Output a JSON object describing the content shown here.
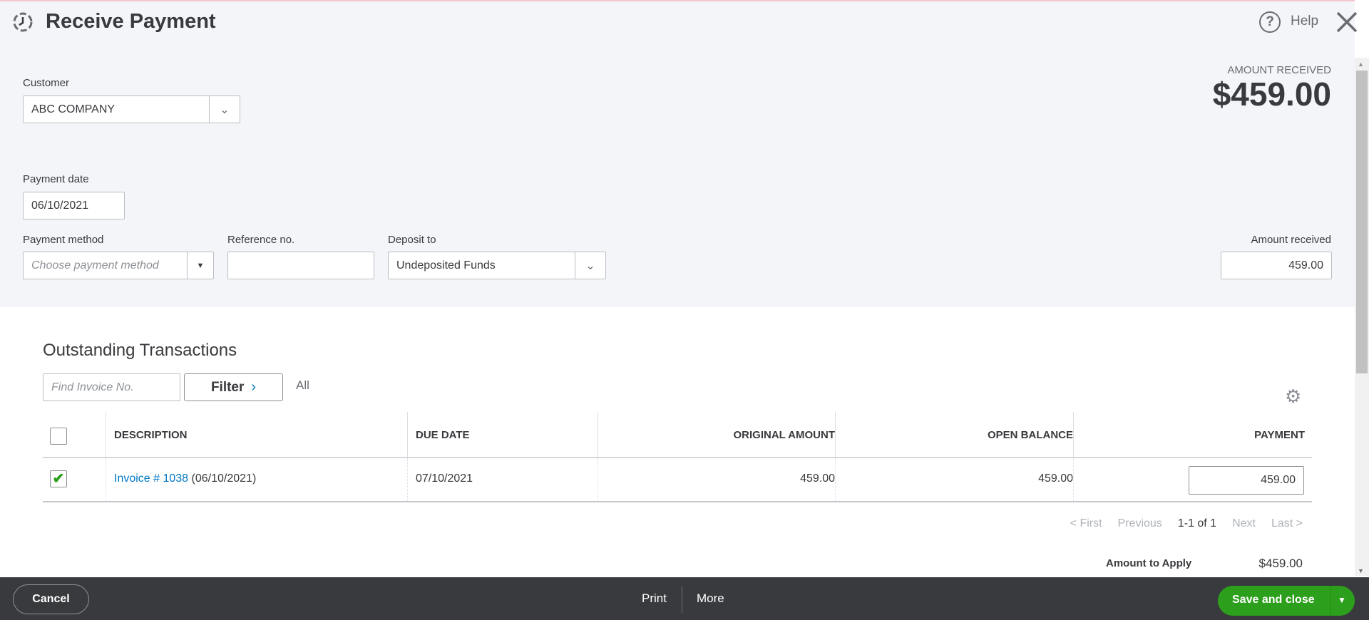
{
  "header": {
    "title": "Receive Payment",
    "help": "Help"
  },
  "amount_summary": {
    "label": "AMOUNT RECEIVED",
    "value": "$459.00"
  },
  "form": {
    "customer": {
      "label": "Customer",
      "value": "ABC COMPANY"
    },
    "payment_date": {
      "label": "Payment date",
      "value": "06/10/2021"
    },
    "payment_method": {
      "label": "Payment method",
      "placeholder": "Choose payment method"
    },
    "reference_no": {
      "label": "Reference no.",
      "value": ""
    },
    "deposit_to": {
      "label": "Deposit to",
      "value": "Undeposited Funds"
    },
    "amount_received": {
      "label": "Amount received",
      "value": "459.00"
    }
  },
  "transactions": {
    "title": "Outstanding Transactions",
    "search_placeholder": "Find Invoice No.",
    "filter_label": "Filter",
    "filter_value": "All",
    "columns": [
      "DESCRIPTION",
      "DUE DATE",
      "ORIGINAL AMOUNT",
      "OPEN BALANCE",
      "PAYMENT"
    ],
    "rows": [
      {
        "checked": true,
        "invoice_link": "Invoice # 1038",
        "invoice_date": "(06/10/2021)",
        "due_date": "07/10/2021",
        "original_amount": "459.00",
        "open_balance": "459.00",
        "payment": "459.00"
      }
    ],
    "pagination": {
      "first": "< First",
      "previous": "Previous",
      "range": "1-1 of 1",
      "next": "Next",
      "last": "Last >"
    },
    "amount_to_apply": {
      "label": "Amount to Apply",
      "value": "$459.00"
    }
  },
  "footer": {
    "cancel": "Cancel",
    "print": "Print",
    "more": "More",
    "save": "Save and close"
  },
  "colors": {
    "accent_green": "#2ca01c",
    "link_blue": "#0077c5",
    "footer_bg": "#393a3d",
    "header_bg": "#f4f5f8"
  }
}
